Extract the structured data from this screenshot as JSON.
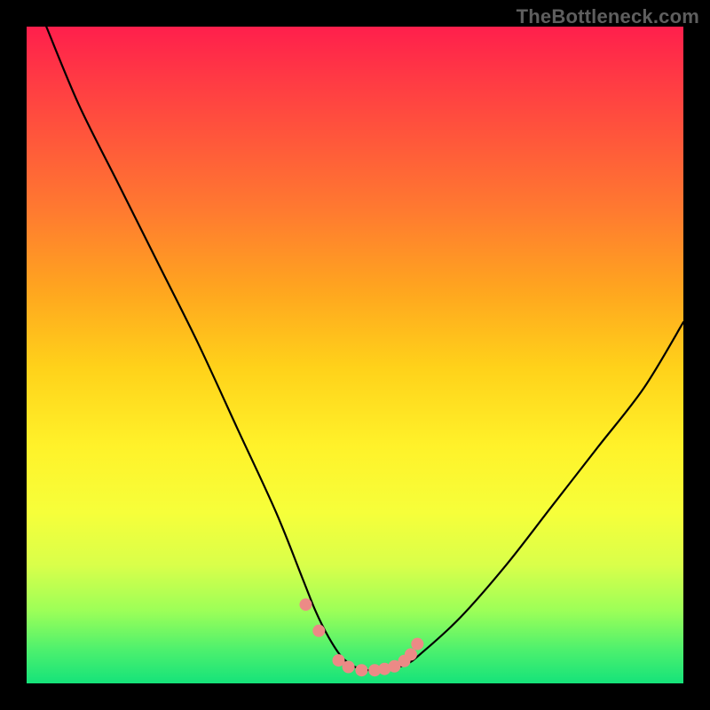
{
  "watermark": "TheBottleneck.com",
  "chart_data": {
    "type": "line",
    "title": "",
    "xlabel": "",
    "ylabel": "",
    "xlim": [
      0,
      100
    ],
    "ylim": [
      0,
      100
    ],
    "series": [
      {
        "name": "curve",
        "color": "#000000",
        "x": [
          3,
          8,
          14,
          20,
          26,
          32,
          38,
          42,
          44,
          46,
          48,
          50,
          52,
          54,
          56,
          58,
          60,
          66,
          73,
          80,
          87,
          94,
          100
        ],
        "y": [
          100,
          88,
          76,
          64,
          52,
          39,
          26,
          16,
          11,
          7,
          4,
          2.5,
          2,
          2,
          2.3,
          3,
          4.5,
          10,
          18,
          27,
          36,
          45,
          55
        ]
      },
      {
        "name": "markers",
        "type": "scatter",
        "color": "#ec8a86",
        "x": [
          42.5,
          44.5,
          47.5,
          49,
          51,
          53,
          54.5,
          56,
          57.5,
          58.5,
          59.5
        ],
        "y": [
          12,
          8,
          3.5,
          2.5,
          2,
          2,
          2.2,
          2.6,
          3.4,
          4.4,
          6
        ]
      }
    ],
    "gradient_stops": [
      {
        "pct": 0,
        "color": "#ff1f4c"
      },
      {
        "pct": 50,
        "color": "#ffe628"
      },
      {
        "pct": 100,
        "color": "#15e37a"
      }
    ]
  }
}
